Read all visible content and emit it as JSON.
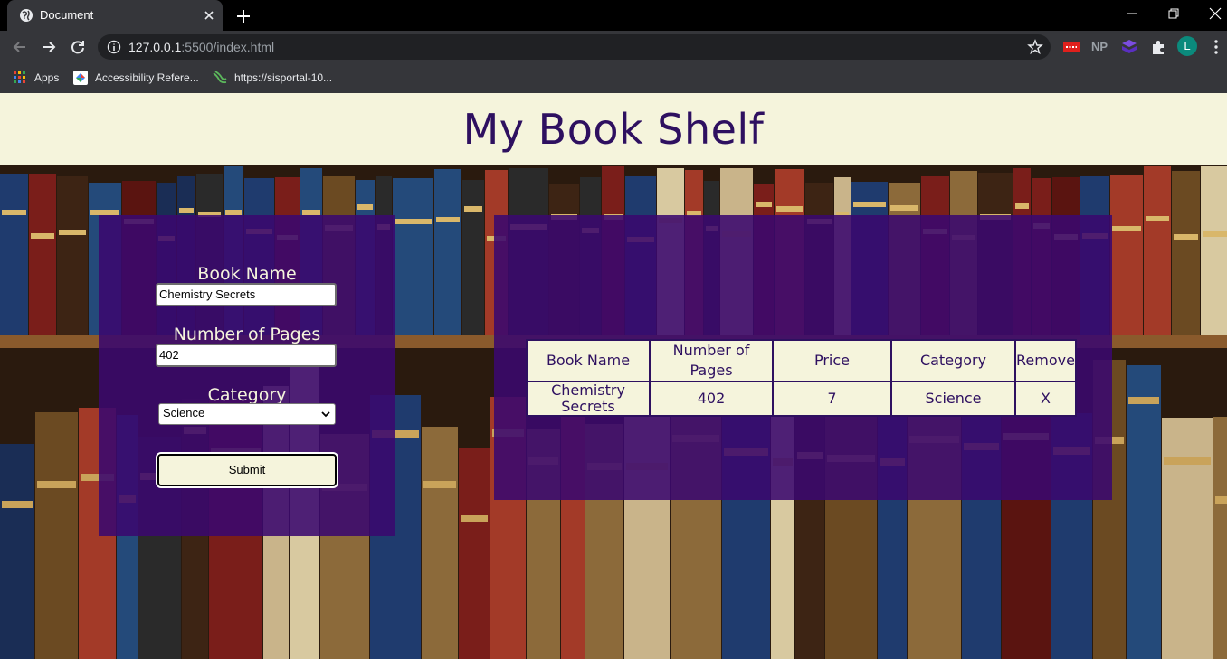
{
  "browser": {
    "tab_title": "Document",
    "url_host": "127.0.0.1",
    "url_rest": ":5500/index.html",
    "bookmarks": [
      {
        "label": "Apps",
        "icon": "apps-grid-icon"
      },
      {
        "label": "Accessibility Refere...",
        "icon": "accessibility-site-icon"
      },
      {
        "label": "https://sisportal-10...",
        "icon": "sisportal-site-icon"
      }
    ],
    "extensions": {
      "np_label": "NP",
      "profile_initial": "L"
    }
  },
  "page": {
    "title": "My Book Shelf",
    "form": {
      "book_name_label": "Book Name",
      "book_name_value": "Chemistry Secrets",
      "pages_label": "Number of Pages",
      "pages_value": "402",
      "category_label": "Category",
      "category_value": "Science",
      "submit_label": "Submit"
    },
    "table": {
      "headers": [
        "Book Name",
        "Number of Pages",
        "Price",
        "Category",
        "Remove"
      ],
      "rows": [
        [
          "Chemistry Secrets",
          "402",
          "7",
          "Science",
          "X"
        ]
      ]
    }
  },
  "colors": {
    "header_bg": "#f5f4dc",
    "title_color": "#2e1060",
    "panel_bg": "#3a086e",
    "chrome_bg": "#35363a"
  }
}
